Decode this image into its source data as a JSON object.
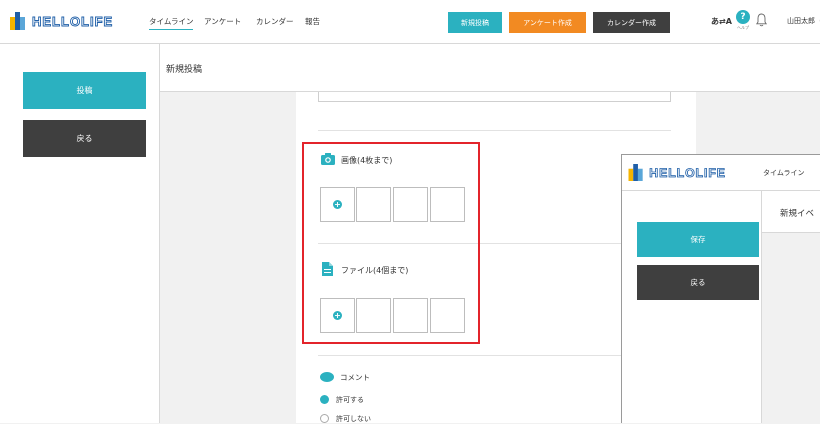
{
  "header": {
    "logo_text": "HELLOLIFE",
    "nav": [
      "タイムライン",
      "アンケート",
      "カレンダー",
      "報告"
    ],
    "buttons": {
      "new_post": "新規投稿",
      "create_survey": "アンケート作成",
      "create_calendar": "カレンダー作成"
    },
    "language": "あ⇄A",
    "help_label": "ヘルプ",
    "user_name": "山田太郎（管理者）"
  },
  "sidebar": {
    "post_button": "投稿",
    "back_button": "戻る"
  },
  "main": {
    "title": "新規投稿",
    "image_section": {
      "label": "画像(4枚まで)"
    },
    "file_section": {
      "label": "ファイル(4個まで)"
    },
    "comment_section": {
      "label": "コメント",
      "options": [
        "許可する",
        "許可しない"
      ],
      "selected": "許可する"
    }
  },
  "overlay": {
    "nav_item": "タイムライン",
    "title": "新規イベ",
    "save_button": "保存",
    "back_button": "戻る"
  },
  "colors": {
    "teal": "#2bb1c0",
    "orange": "#f28a22",
    "dark": "#3f3f3f",
    "highlight": "#e3242b",
    "logo_blue": "#1f5fa8"
  }
}
